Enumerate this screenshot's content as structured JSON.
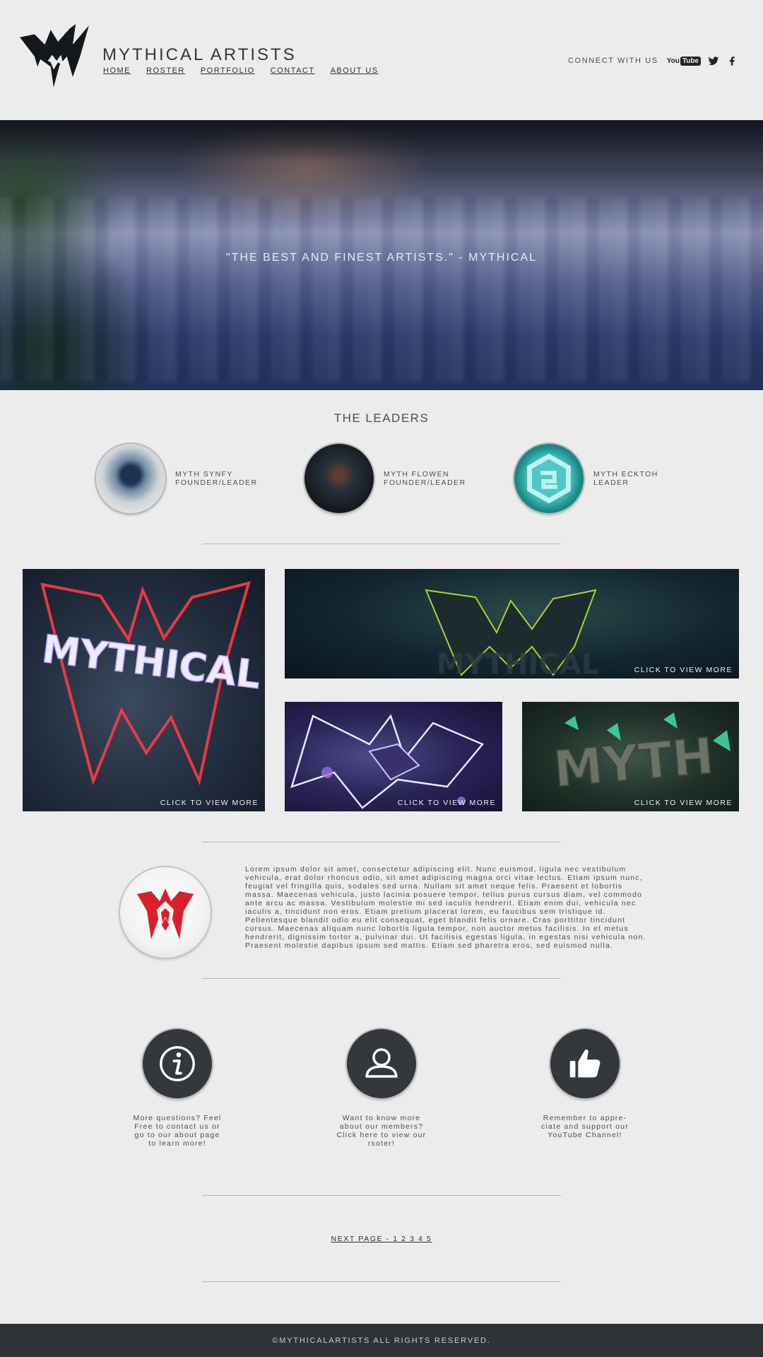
{
  "header": {
    "site_title": "MYTHICAL ARTISTS",
    "nav": [
      {
        "label": "HOME"
      },
      {
        "label": "ROSTER"
      },
      {
        "label": "PORTFOLIO"
      },
      {
        "label": "CONTACT"
      },
      {
        "label": "ABOUT US"
      }
    ],
    "connect_label": "CONNECT WITH US",
    "social": {
      "youtube_you": "You",
      "youtube_tube": "Tube",
      "twitter_icon": "twitter-icon",
      "facebook_icon": "facebook-icon"
    }
  },
  "hero": {
    "quote": "\"THE BEST AND FINEST ARTISTS.\" - MYTHICAL"
  },
  "leaders": {
    "title": "THE LEADERS",
    "items": [
      {
        "name": "MYTH SYNFY",
        "role": "FOUNDER/LEADER"
      },
      {
        "name": "MYTH FLOWEN",
        "role": "FOUNDER/LEADER"
      },
      {
        "name": "MYTH ECKTOH",
        "role": "LEADER"
      }
    ]
  },
  "portfolio": {
    "tiles": [
      {
        "cta": "CLICK TO VIEW MORE",
        "art_text": "MYTHICAL"
      },
      {
        "cta": "CLICK TO VIEW MORE",
        "art_text": "MYTHICAL"
      },
      {
        "cta": "CLICK TO VIEW MORE"
      },
      {
        "cta": "CLICK TO VIEW MORE",
        "art_text": "MYTH"
      }
    ]
  },
  "about": {
    "text": "Lorem ipsum dolor sit amet, consectetur adipiscing elit. Nunc euismod, ligula nec vestibulum vehicula, erat dolor rhoncus odio, sit amet adipiscing magna orci vitae lectus. Etiam ipsum nunc, feugiat vel fringilla quis, sodales sed urna. Nullam sit amet neque felis. Praesent et lobortis massa. Maecenas vehicula, justo lacinia posuere tempor, tellus purus cursus diam, vel commodo ante arcu ac massa. Vestibulum molestie mi sed iaculis hendrerit. Etiam enim dui, vehicula nec iaculis a, tincidunt non eros. Etiam pretium placerat lorem, eu faucibus sem tristique id. Pellentesque blandit odio eu elit consequat, eget blandit felis ornare. Cras porttitor tincidunt cursus. Maecenas aliquam nunc lobortis ligula tempor, non auctor metus facilisis. In et metus hendrerit, dignissim tortor a, pulvinar dui. Ut facilisis egestas ligula, in egestas nisi vehicula non. Praesent molestie dapibus ipsum sed mattis. Etiam sed pharetra eros, sed euismod nulla."
  },
  "features": [
    {
      "icon": "info-icon",
      "text": "More questions? Feel Free to contact us or go to our about page to learn more!"
    },
    {
      "icon": "user-icon",
      "text": "Want to know more about our members? Click here to view our rsoter!"
    },
    {
      "icon": "thumbs-up-icon",
      "text": "Remember to appre-ciate and support our YouTube Channel!"
    }
  ],
  "pager": {
    "label": "NEXT PAGE - 1 2 3 4 5"
  },
  "footer": {
    "text": "©MYTHICALARTISTS ALL RIGHTS RESERVED."
  },
  "colors": {
    "background": "#ececec",
    "dark": "#2f3338",
    "accent_red": "#d8202a"
  }
}
